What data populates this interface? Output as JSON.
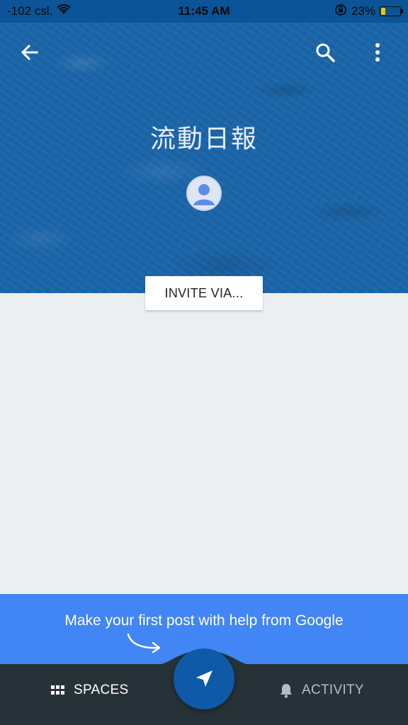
{
  "status_bar": {
    "carrier": "-102 csl.",
    "time": "11:45 AM",
    "battery_percent": "23%",
    "battery_level": 0.23,
    "icons": [
      "wifi-icon",
      "rotation-lock-icon",
      "battery-icon"
    ]
  },
  "header": {
    "back_icon": "arrow-left-icon",
    "search_icon": "search-icon",
    "more_icon": "more-vert-icon",
    "space_title": "流動日報",
    "avatar_icon": "person-icon",
    "invite_label": "INVITE VIA..."
  },
  "promo": {
    "text": "Make your first post with help from Google",
    "arrow_icon": "curved-arrow-icon"
  },
  "bottom_nav": {
    "spaces_label": "SPACES",
    "spaces_icon": "grid-icon",
    "activity_label": "ACTIVITY",
    "activity_icon": "bell-icon",
    "fab_icon": "send-icon"
  },
  "colors": {
    "header_blue": "#1a64a8",
    "promo_blue": "#4285f4",
    "nav_dark": "#263238",
    "fab_blue": "#0f5aa8",
    "content_gray": "#eceff1"
  }
}
